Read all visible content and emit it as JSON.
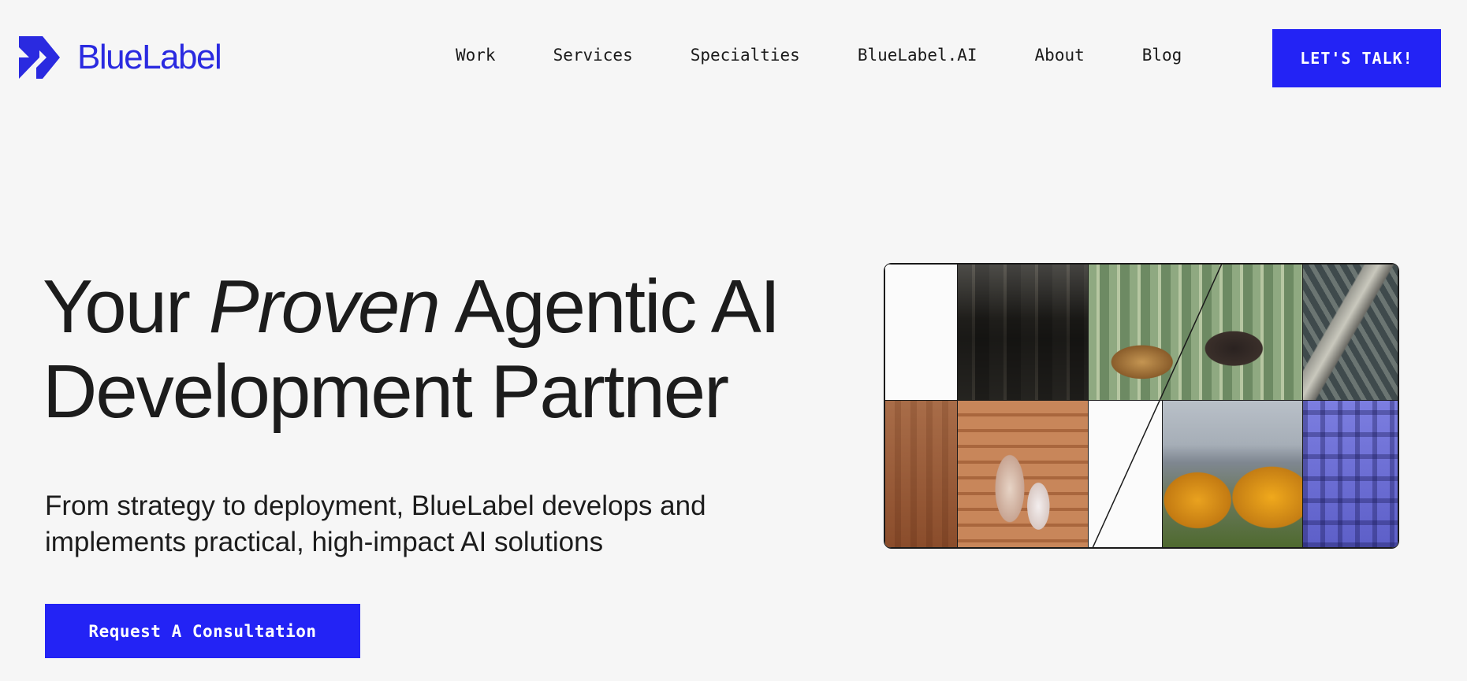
{
  "brand": {
    "name": "BlueLabel",
    "color": "#2a2ae0",
    "logo_icon": "double-chevron-logo-icon"
  },
  "nav": {
    "items": [
      "Work",
      "Services",
      "Specialties",
      "BlueLabel.AI",
      "About",
      "Blog"
    ],
    "cta_label": "LET'S TALK!",
    "cta_color": "#2323f5"
  },
  "hero": {
    "headline_prefix": "Your",
    "headline_emphasis": "Proven",
    "headline_line1_rest": "Agentic AI",
    "headline_line2": "Development Partner",
    "subtitle_line1": "From strategy to deployment, BlueLabel develops and",
    "subtitle_line2": "implements practical, high-impact AI solutions",
    "cta_label": "Request A Consultation"
  },
  "collage": {
    "images": [
      "cafe-interior-photo",
      "bakery-counter-photo",
      "aerial-bridge-photo",
      "wood-wall-photo",
      "children-on-stairs-photo",
      "city-autumn-trees-photo",
      "aerial-city-blue-photo"
    ]
  }
}
